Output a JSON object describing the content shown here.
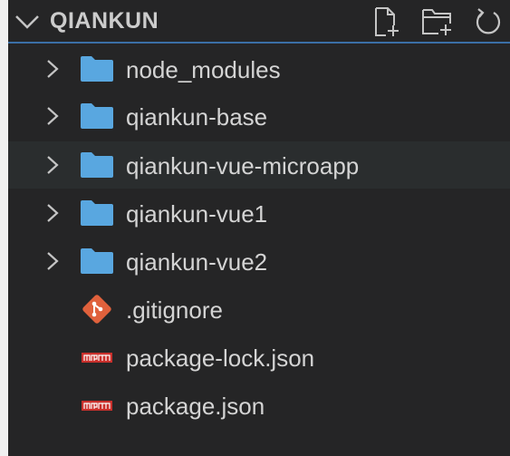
{
  "explorer": {
    "title": "QIANKUN",
    "actions": [
      {
        "name": "new-file-icon"
      },
      {
        "name": "new-folder-icon"
      },
      {
        "name": "refresh-icon"
      }
    ]
  },
  "tree": {
    "items": [
      {
        "label": "node_modules",
        "type": "folder"
      },
      {
        "label": "qiankun-base",
        "type": "folder"
      },
      {
        "label": "qiankun-vue-microapp",
        "type": "folder"
      },
      {
        "label": "qiankun-vue1",
        "type": "folder"
      },
      {
        "label": "qiankun-vue2",
        "type": "folder"
      },
      {
        "label": ".gitignore",
        "type": "file",
        "icon": "git-icon"
      },
      {
        "label": "package-lock.json",
        "type": "file",
        "icon": "npm-icon"
      },
      {
        "label": "package.json",
        "type": "file",
        "icon": "npm-icon"
      }
    ]
  },
  "colors": {
    "background": "#252526",
    "folder": "#59a7e0",
    "git": "#e0613c",
    "npm": "#c9302c",
    "text": "#d4d4d4",
    "focus_border": "#3b6fa6"
  }
}
